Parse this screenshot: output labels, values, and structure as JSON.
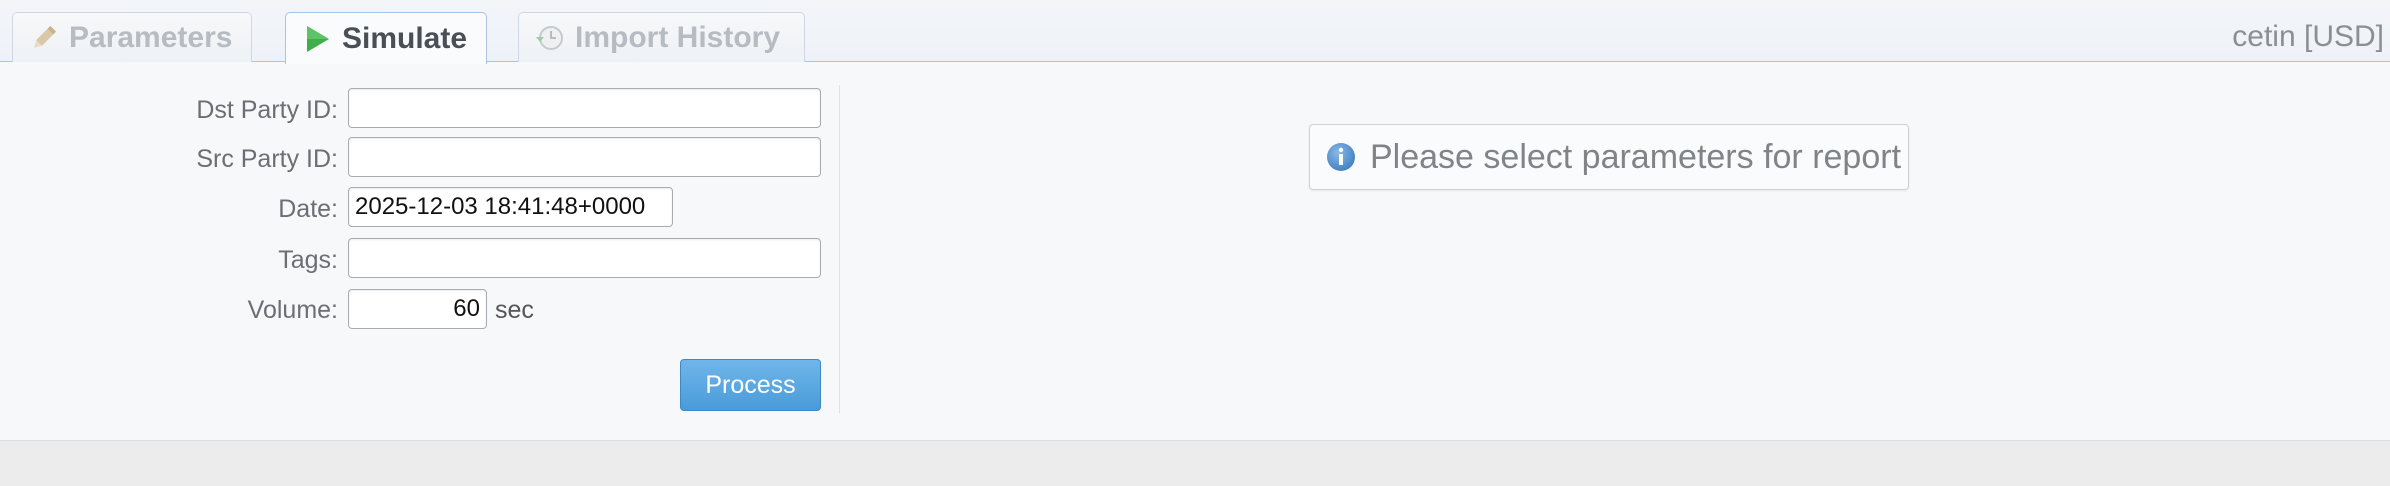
{
  "tabs": [
    {
      "label": "Parameters",
      "icon": "pencil-icon",
      "active": false
    },
    {
      "label": "Simulate",
      "icon": "play-icon",
      "active": true
    },
    {
      "label": "Import History",
      "icon": "history-icon",
      "active": false
    }
  ],
  "user": {
    "label": "cetin [USD]"
  },
  "form": {
    "dst_party_id": {
      "label": "Dst Party ID:",
      "value": ""
    },
    "src_party_id": {
      "label": "Src Party ID:",
      "value": ""
    },
    "date": {
      "label": "Date:",
      "value": "2025-12-03 18:41:48+0000"
    },
    "tags": {
      "label": "Tags:",
      "value": ""
    },
    "volume": {
      "label": "Volume:",
      "value": "60",
      "unit": "sec"
    },
    "process_label": "Process"
  },
  "notice": {
    "text": "Please select parameters for report",
    "icon": "info-icon"
  },
  "colors": {
    "accent": "#4a9bd9",
    "tab_border": "#a9c4de",
    "play_green": "#3fae49",
    "info_blue": "#3d7fc1"
  }
}
